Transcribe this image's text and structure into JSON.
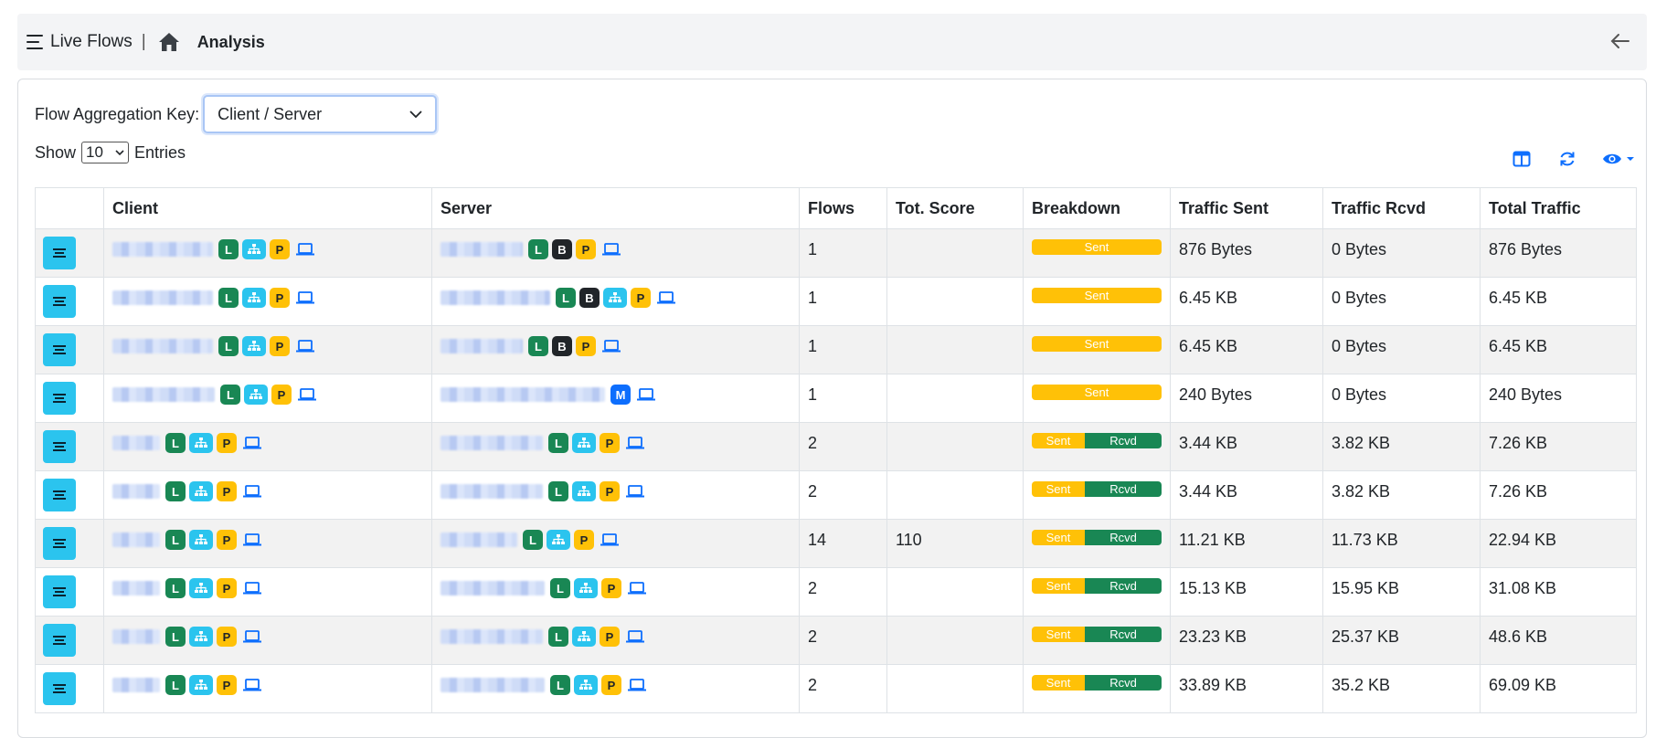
{
  "header": {
    "title": "Live Flows",
    "separator": "|",
    "breadcrumb": "Analysis"
  },
  "controls": {
    "aggregation_label": "Flow Aggregation Key:",
    "aggregation_value": "Client / Server",
    "show_label": "Show",
    "show_value": "10",
    "entries_label": "Entries"
  },
  "table": {
    "columns": [
      "",
      "Client",
      "Server",
      "Flows",
      "Tot. Score",
      "Breakdown",
      "Traffic Sent",
      "Traffic Rcvd",
      "Total Traffic"
    ],
    "sent_label": "Sent",
    "rcvd_label": "Rcvd",
    "rows": [
      {
        "client_badges": [
          "L",
          "N",
          "P"
        ],
        "server_badges": [
          "L",
          "B",
          "P"
        ],
        "flows": "1",
        "score": "",
        "breakdown": "sent",
        "sent": "876 Bytes",
        "rcvd": "0 Bytes",
        "total": "876 Bytes"
      },
      {
        "client_badges": [
          "L",
          "N",
          "P"
        ],
        "server_badges": [
          "L",
          "B",
          "N",
          "P"
        ],
        "flows": "1",
        "score": "",
        "breakdown": "sent",
        "sent": "6.45 KB",
        "rcvd": "0 Bytes",
        "total": "6.45 KB"
      },
      {
        "client_badges": [
          "L",
          "N",
          "P"
        ],
        "server_badges": [
          "L",
          "B",
          "P"
        ],
        "flows": "1",
        "score": "",
        "breakdown": "sent",
        "sent": "6.45 KB",
        "rcvd": "0 Bytes",
        "total": "6.45 KB"
      },
      {
        "client_badges": [
          "L",
          "N",
          "P"
        ],
        "server_badges": [
          "M"
        ],
        "flows": "1",
        "score": "",
        "breakdown": "sent",
        "sent": "240 Bytes",
        "rcvd": "0 Bytes",
        "total": "240 Bytes"
      },
      {
        "client_badges": [
          "L",
          "N",
          "P"
        ],
        "server_badges": [
          "L",
          "N",
          "P"
        ],
        "flows": "2",
        "score": "",
        "breakdown": "both",
        "sent": "3.44 KB",
        "rcvd": "3.82 KB",
        "total": "7.26 KB"
      },
      {
        "client_badges": [
          "L",
          "N",
          "P"
        ],
        "server_badges": [
          "L",
          "N",
          "P"
        ],
        "flows": "2",
        "score": "",
        "breakdown": "both",
        "sent": "3.44 KB",
        "rcvd": "3.82 KB",
        "total": "7.26 KB"
      },
      {
        "client_badges": [
          "L",
          "N",
          "P"
        ],
        "server_badges": [
          "L",
          "N",
          "P"
        ],
        "flows": "14",
        "score": "110",
        "breakdown": "both",
        "sent": "11.21 KB",
        "rcvd": "11.73 KB",
        "total": "22.94 KB"
      },
      {
        "client_badges": [
          "L",
          "N",
          "P"
        ],
        "server_badges": [
          "L",
          "N",
          "P"
        ],
        "flows": "2",
        "score": "",
        "breakdown": "both",
        "sent": "15.13 KB",
        "rcvd": "15.95 KB",
        "total": "31.08 KB"
      },
      {
        "client_badges": [
          "L",
          "N",
          "P"
        ],
        "server_badges": [
          "L",
          "N",
          "P"
        ],
        "flows": "2",
        "score": "",
        "breakdown": "both",
        "sent": "23.23 KB",
        "rcvd": "25.37 KB",
        "total": "48.6 KB"
      },
      {
        "client_badges": [
          "L",
          "N",
          "P"
        ],
        "server_badges": [
          "L",
          "N",
          "P"
        ],
        "flows": "2",
        "score": "",
        "breakdown": "both",
        "sent": "33.89 KB",
        "rcvd": "35.2 KB",
        "total": "69.09 KB"
      }
    ]
  },
  "icons": {
    "menu": "hamburger-icon",
    "home": "home-icon",
    "back": "arrow-left-icon",
    "columns": "columns-icon",
    "refresh": "refresh-icon",
    "visibility": "eye-icon",
    "network": "sitemap-icon",
    "device": "laptop-icon"
  },
  "colors": {
    "accent": "#0d6efd",
    "action_button": "#2bc4ee",
    "badge_local": "#198754",
    "badge_blacklist": "#212529",
    "badge_private": "#ffc107",
    "badge_multicast": "#0d6efd",
    "breakdown_sent": "#ffc107",
    "breakdown_rcvd": "#198754"
  }
}
